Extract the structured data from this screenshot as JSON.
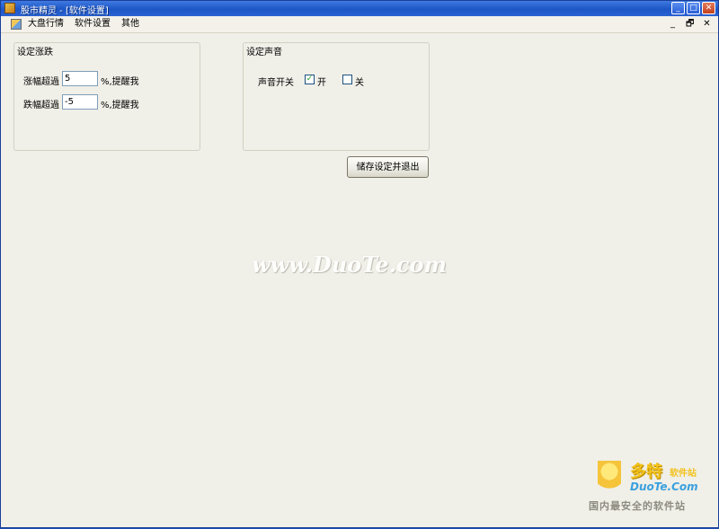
{
  "window": {
    "title": "股市精灵 - [软件设置]",
    "caption_buttons": {
      "minimize": "_",
      "maximize": "□",
      "close": "✕"
    }
  },
  "menubar": {
    "items": [
      {
        "label": "大盘行情"
      },
      {
        "label": "软件设置"
      },
      {
        "label": "其他"
      }
    ],
    "mdi_controls": {
      "minimize": "_",
      "restore": "🗗",
      "close": "✕"
    }
  },
  "rise_fall_group": {
    "title": "设定涨跌",
    "rise": {
      "label": "涨幅超過",
      "value": "5",
      "suffix": "%,提醒我"
    },
    "fall": {
      "label": "跌幅超過",
      "value": "-5",
      "suffix": "%,提醒我"
    }
  },
  "sound_group": {
    "title": "设定声音",
    "switch_label": "声音开关",
    "on": {
      "label": "开",
      "checked": true,
      "mark": "✓"
    },
    "off": {
      "label": "关",
      "checked": false,
      "mark": ""
    }
  },
  "save_button": {
    "label": "储存设定并退出"
  },
  "watermark": {
    "text": "www.DuoTe.com"
  },
  "corner_logo": {
    "big_text": "多特",
    "small_text": "软件站",
    "brand": "DuoTe.Com",
    "slogan": "国内最安全的软件站"
  },
  "colors": {
    "titlebar": "#1d56c6",
    "window_bg": "#f0efe8",
    "input_border": "#7f9db9",
    "check_mark": "#21a121"
  }
}
